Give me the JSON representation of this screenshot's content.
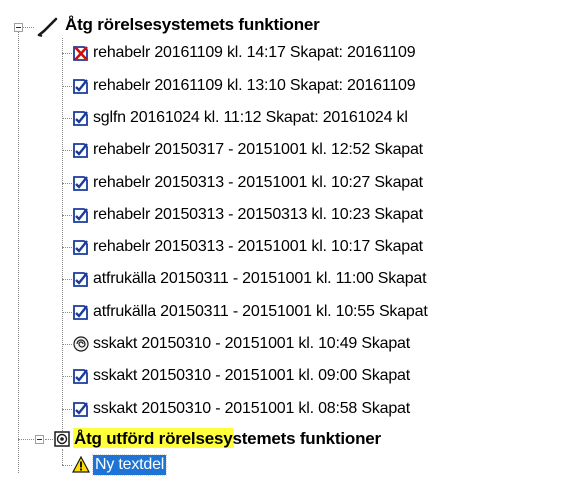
{
  "tree": {
    "root": {
      "label": "Åtg rörelsesystemets funktioner",
      "icon": "check-mark-icon"
    },
    "items": [
      {
        "label": "rehabelr 20161109  kl. 14:17  Skapat: 20161109",
        "icon": "document-cross-icon"
      },
      {
        "label": "rehabelr 20161109  kl. 13:10  Skapat: 20161109",
        "icon": "document-check-icon"
      },
      {
        "label": "sglfn 20161024  kl. 11:12  Skapat: 20161024 kl",
        "icon": "document-check-icon"
      },
      {
        "label": "rehabelr 20150317 - 20151001  kl. 12:52  Skapat",
        "icon": "document-check-icon"
      },
      {
        "label": "rehabelr 20150313 - 20151001  kl. 10:27  Skapat",
        "icon": "document-check-icon"
      },
      {
        "label": "rehabelr 20150313 - 20150313  kl. 10:23  Skapat",
        "icon": "document-check-icon"
      },
      {
        "label": "rehabelr 20150313 - 20151001  kl. 10:17  Skapat",
        "icon": "document-check-icon"
      },
      {
        "label": "atfrukälla 20150311 - 20151001  kl. 11:00  Skapat",
        "icon": "document-check-icon"
      },
      {
        "label": "atfrukälla 20150311 - 20151001  kl. 10:55  Skapat",
        "icon": "document-check-icon"
      },
      {
        "label": "sskakt 20150310 - 20151001  kl. 10:49  Skapat",
        "icon": "spiral-icon"
      },
      {
        "label": "sskakt 20150310 - 20151001  kl. 09:00  Skapat",
        "icon": "document-check-icon"
      },
      {
        "label": "sskakt 20150310 - 20151001  kl. 08:58  Skapat",
        "icon": "document-check-icon"
      }
    ],
    "second": {
      "label": "Åtg utförd rörelsesystemets funktioner",
      "icon": "clipboard-icon"
    },
    "child": {
      "label": "Ny textdel",
      "icon": "warning-icon"
    }
  },
  "colors": {
    "selection": "#1e73d6",
    "highlight": "#ffff3a",
    "check_blue": "#1a3b9c",
    "cross_red": "#cc1010"
  }
}
